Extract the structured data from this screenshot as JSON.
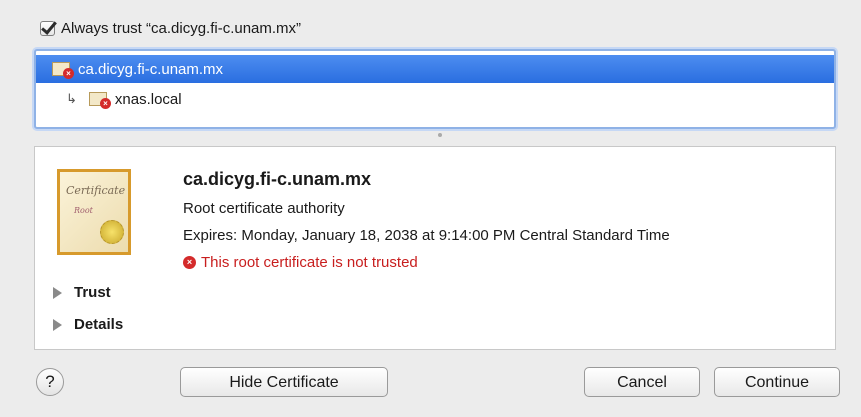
{
  "trust_checkbox": {
    "label": "Always trust “ca.dicyg.fi-c.unam.mx”",
    "checked": true
  },
  "chain": {
    "items": [
      {
        "label": "ca.dicyg.fi-c.unam.mx",
        "selected": true,
        "icon": "certificate-error-icon"
      },
      {
        "label": "xnas.local",
        "selected": false,
        "icon": "certificate-error-icon"
      }
    ]
  },
  "certificate": {
    "name": "ca.dicyg.fi-c.unam.mx",
    "type": "Root certificate authority",
    "expires": "Expires: Monday, January 18, 2038 at 9:14:00 PM Central Standard Time",
    "status": "This root certificate is not trusted",
    "status_color": "#c81e1e",
    "image_text": {
      "title": "Certificate",
      "subtitle": "Root"
    }
  },
  "disclosures": {
    "trust": "Trust",
    "details": "Details"
  },
  "buttons": {
    "help": "?",
    "hide_certificate": "Hide Certificate",
    "cancel": "Cancel",
    "continue": "Continue"
  },
  "colors": {
    "selection": "#2a6ee0",
    "error": "#d42b2b",
    "cert_border": "#d79a2c"
  }
}
